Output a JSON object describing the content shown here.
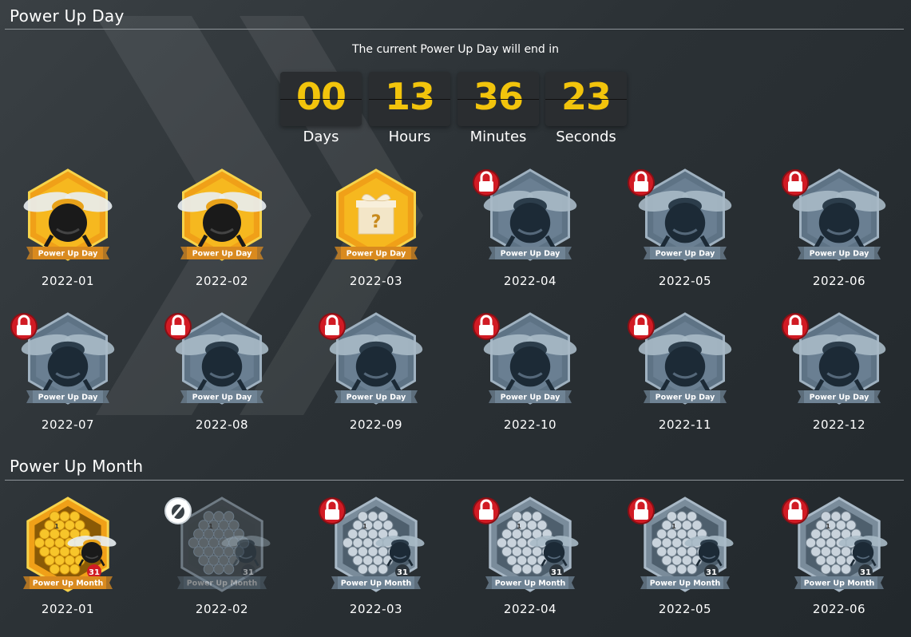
{
  "power_up_day": {
    "title": "Power Up Day",
    "ends_label": "The current Power Up Day will end in",
    "countdown": [
      {
        "value": "00",
        "unit": "Days"
      },
      {
        "value": "13",
        "unit": "Hours"
      },
      {
        "value": "36",
        "unit": "Minutes"
      },
      {
        "value": "23",
        "unit": "Seconds"
      }
    ],
    "badge_label": "Power Up Day",
    "badges": [
      {
        "date": "2022-01",
        "state": "earned"
      },
      {
        "date": "2022-02",
        "state": "earned"
      },
      {
        "date": "2022-03",
        "state": "gift"
      },
      {
        "date": "2022-04",
        "state": "locked"
      },
      {
        "date": "2022-05",
        "state": "locked"
      },
      {
        "date": "2022-06",
        "state": "locked"
      },
      {
        "date": "2022-07",
        "state": "locked"
      },
      {
        "date": "2022-08",
        "state": "locked"
      },
      {
        "date": "2022-09",
        "state": "locked"
      },
      {
        "date": "2022-10",
        "state": "locked"
      },
      {
        "date": "2022-11",
        "state": "locked"
      },
      {
        "date": "2022-12",
        "state": "locked"
      }
    ]
  },
  "power_up_month": {
    "title": "Power Up Month",
    "badge_label": "Power Up Month",
    "badge_numbers": [
      "1",
      "31"
    ],
    "badges": [
      {
        "date": "2022-01",
        "state": "earned"
      },
      {
        "date": "2022-02",
        "state": "missed"
      },
      {
        "date": "2022-03",
        "state": "locked"
      },
      {
        "date": "2022-04",
        "state": "locked"
      },
      {
        "date": "2022-05",
        "state": "locked"
      },
      {
        "date": "2022-06",
        "state": "locked"
      }
    ]
  },
  "colors": {
    "accent_yellow": "#f2c40c",
    "lock_red": "#d11b24",
    "ribbon_orange": "#d98a1f",
    "locked_gray": "#6f8394"
  },
  "icons": [
    "bee-icon",
    "gift-icon",
    "lock-icon",
    "missed-icon",
    "honeycomb-icon"
  ]
}
